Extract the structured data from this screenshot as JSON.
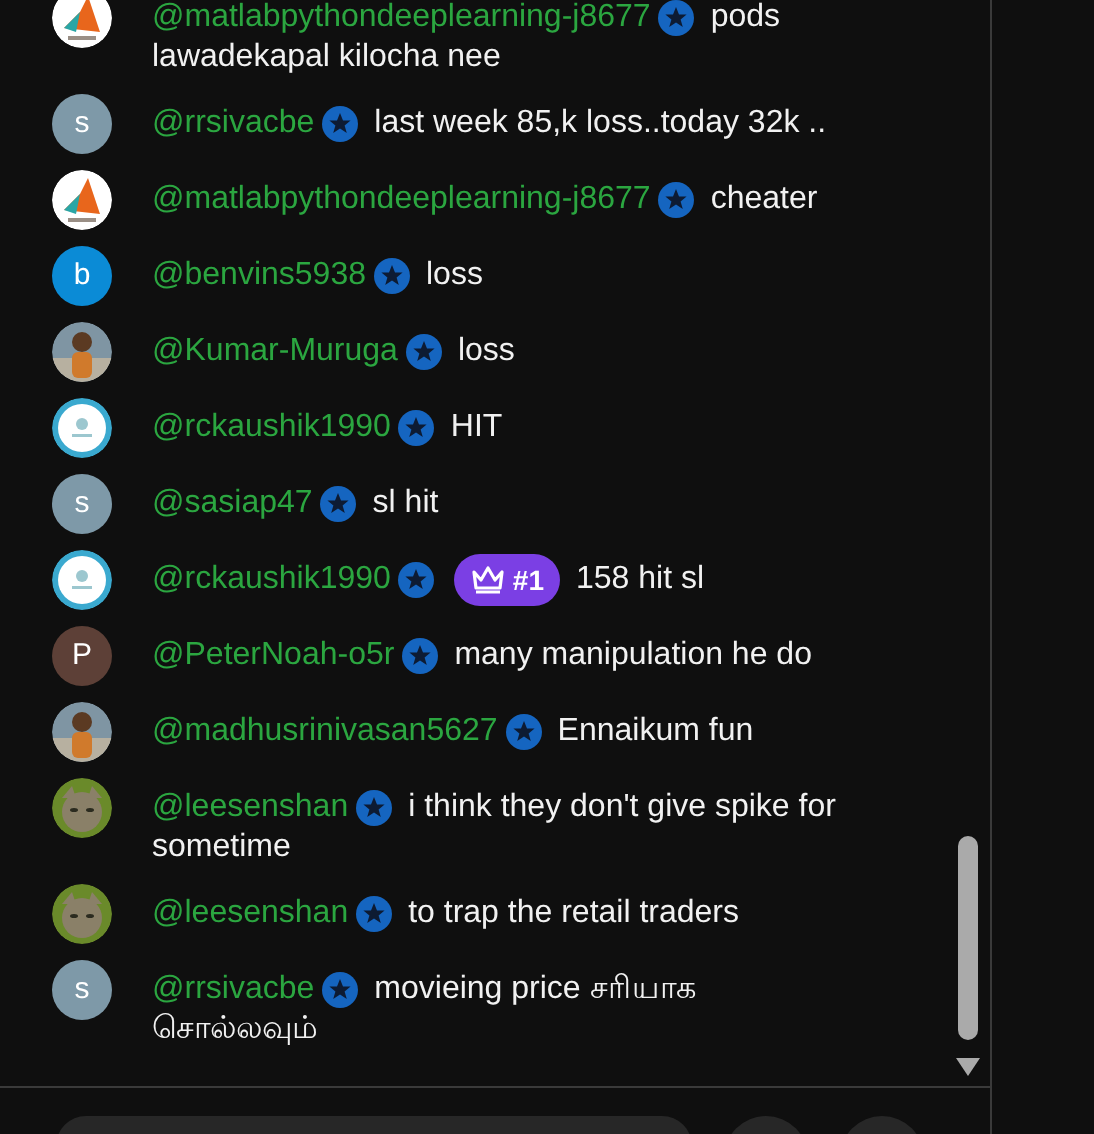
{
  "messages": [
    {
      "avatar": {
        "kind": "picture"
      },
      "author": "@matlabpythondeeplearning-j8677",
      "member": true,
      "lines": [
        "pods",
        "lawadekapal kilocha nee"
      ]
    },
    {
      "avatar": {
        "kind": "letter",
        "letter": "s",
        "color": "#7e99a8"
      },
      "author": "@rrsivacbe",
      "member": true,
      "lines": [
        "last week 85,k loss..today 32k .."
      ]
    },
    {
      "avatar": {
        "kind": "picture"
      },
      "author": "@matlabpythondeeplearning-j8677",
      "member": true,
      "lines": [
        "cheater"
      ]
    },
    {
      "avatar": {
        "kind": "letter",
        "letter": "b",
        "color": "#0b8bd6"
      },
      "author": "@benvins5938",
      "member": true,
      "lines": [
        "loss"
      ]
    },
    {
      "avatar": {
        "kind": "picture"
      },
      "author": "@Kumar-Muruga",
      "member": true,
      "lines": [
        "loss"
      ]
    },
    {
      "avatar": {
        "kind": "picture"
      },
      "author": "@rckaushik1990",
      "member": true,
      "lines": [
        "HIT"
      ]
    },
    {
      "avatar": {
        "kind": "letter",
        "letter": "s",
        "color": "#7e99a8"
      },
      "author": "@sasiap47",
      "member": true,
      "lines": [
        "sl hit"
      ]
    },
    {
      "avatar": {
        "kind": "picture"
      },
      "author": "@rckaushik1990",
      "member": true,
      "badge": {
        "kind": "rank",
        "label": "#1"
      },
      "lines": [
        "158 hit sl"
      ]
    },
    {
      "avatar": {
        "kind": "letter",
        "letter": "P",
        "color": "#5d4037"
      },
      "author": "@PeterNoah-o5r",
      "member": true,
      "lines": [
        "many manipulation he do"
      ]
    },
    {
      "avatar": {
        "kind": "picture"
      },
      "author": "@madhusrinivasan5627",
      "member": true,
      "lines": [
        "Ennaikum fun"
      ]
    },
    {
      "avatar": {
        "kind": "picture"
      },
      "author": "@leesenshan",
      "member": true,
      "lines": [
        "i think they don't give spike for",
        "sometime"
      ]
    },
    {
      "avatar": {
        "kind": "picture"
      },
      "author": "@leesenshan",
      "member": true,
      "lines": [
        "to trap the retail traders"
      ]
    },
    {
      "avatar": {
        "kind": "letter",
        "letter": "s",
        "color": "#7e99a8"
      },
      "author": "@rrsivacbe",
      "member": true,
      "lines": [
        "movieing price சரியாக",
        "சொல்லவும்"
      ]
    }
  ]
}
